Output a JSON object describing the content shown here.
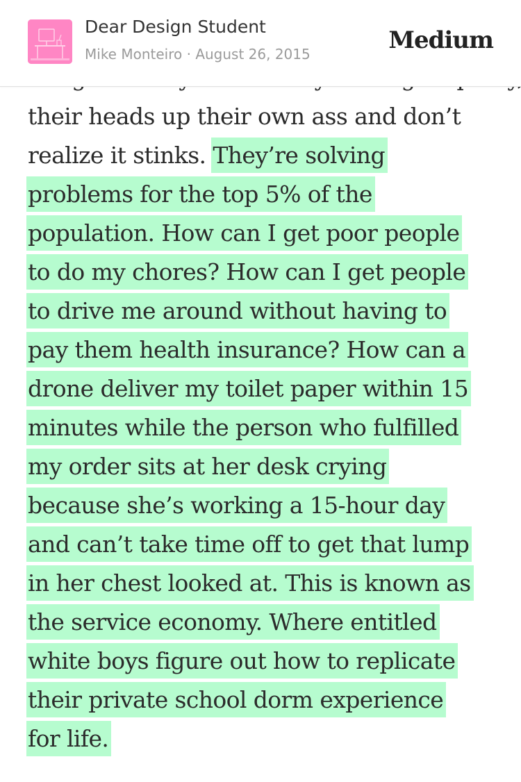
{
  "header": {
    "title": "Dear Design Student",
    "author": "Mike Monteiro",
    "separator": " · ",
    "date": "August 26, 2015",
    "brand": "Medium",
    "thumbnail_icon": "desk-illustration-icon",
    "thumbnail_color": "#ff86c4"
  },
  "article": {
    "highlight_color": "#b6fccf",
    "lines": [
      {
        "plain": "are great at systematically lacking empathy, ",
        "highlight": ""
      },
      {
        "plain": "their heads up their own ass and don’t",
        "highlight": ""
      },
      {
        "plain": "realize it stinks. ",
        "highlight": "They’re solving"
      },
      {
        "plain": "",
        "highlight": "problems for the top 5% of the"
      },
      {
        "plain": "",
        "highlight": "population. How can I get poor people"
      },
      {
        "plain": "",
        "highlight": "to do my chores? How can I get people"
      },
      {
        "plain": "",
        "highlight": "to drive me around without having to"
      },
      {
        "plain": "",
        "highlight": "pay them health insurance? How can a"
      },
      {
        "plain": "",
        "highlight": "drone deliver my toilet paper within 15"
      },
      {
        "plain": "",
        "highlight": "minutes while the person who fulfilled"
      },
      {
        "plain": "",
        "highlight": "my order sits at her desk crying"
      },
      {
        "plain": "",
        "highlight": "because she’s working a 15-hour day"
      },
      {
        "plain": "",
        "highlight": "and can’t take time off to get that lump"
      },
      {
        "plain": "",
        "highlight": "in her chest looked at. This is known as"
      },
      {
        "plain": "",
        "highlight": "the service economy. Where entitled"
      },
      {
        "plain": "",
        "highlight": "white boys figure out how to replicate"
      },
      {
        "plain": "",
        "highlight": "their private school dorm experience"
      },
      {
        "plain": "",
        "highlight": "for life."
      }
    ]
  }
}
